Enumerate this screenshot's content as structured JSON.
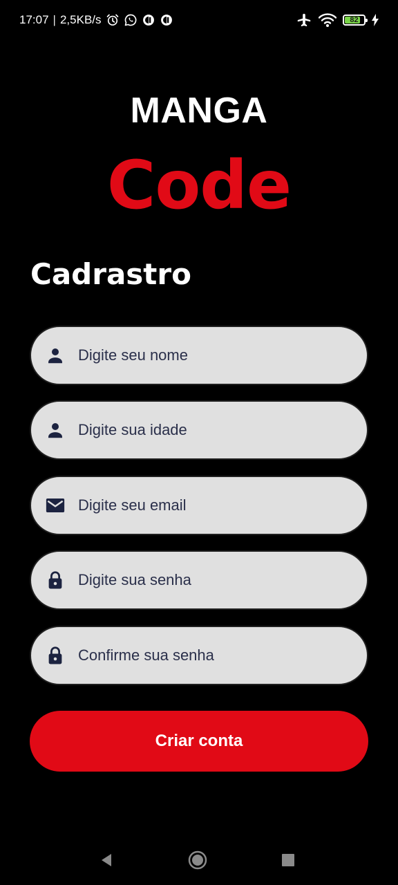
{
  "status_bar": {
    "time": "17:07",
    "separator": "|",
    "network_speed": "2,5KB/s",
    "left_icons": [
      "alarm-icon",
      "whatsapp-icon",
      "notification-app-icon",
      "notification-app-icon"
    ],
    "right_icons": [
      "airplane-mode-icon",
      "wifi-icon",
      "battery-icon",
      "charging-icon"
    ],
    "battery_level": "82",
    "battery_fraction": 0.82
  },
  "brand": {
    "line1": "MANGA",
    "line2": "Code"
  },
  "page_title": "Cadrastro",
  "fields": {
    "name": {
      "icon": "person-icon",
      "placeholder": "Digite seu nome",
      "value": ""
    },
    "age": {
      "icon": "person-icon",
      "placeholder": "Digite sua idade",
      "value": ""
    },
    "email": {
      "icon": "mail-icon",
      "placeholder": "Digite seu email",
      "value": ""
    },
    "password": {
      "icon": "lock-icon",
      "placeholder": "Digite sua senha",
      "value": ""
    },
    "confirm_password": {
      "icon": "lock-icon",
      "placeholder": "Confirme sua senha",
      "value": ""
    }
  },
  "submit_label": "Criar conta",
  "navigation": [
    "back-icon",
    "home-icon",
    "recents-icon"
  ],
  "colors": {
    "background": "#000000",
    "accent": "#e10a16",
    "field_background": "#e0e0e0",
    "field_text": "#1c2340"
  }
}
